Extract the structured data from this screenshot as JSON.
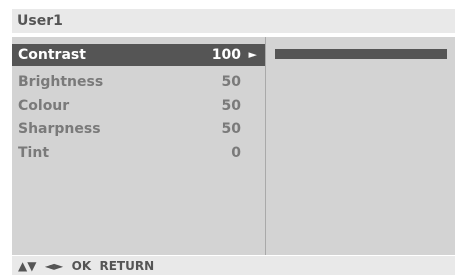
{
  "header": {
    "title": "User1"
  },
  "menu": {
    "items": [
      {
        "label": "Contrast",
        "value": "100",
        "arrow": "►",
        "selected": true
      },
      {
        "label": "Brightness",
        "value": "50"
      },
      {
        "label": "Colour",
        "value": "50"
      },
      {
        "label": "Sharpness",
        "value": "50"
      },
      {
        "label": "Tint",
        "value": "0"
      }
    ]
  },
  "level_bar": {
    "value": 100,
    "max": 100
  },
  "footer": {
    "hints": "▲▼  ◄►  OK  RETURN"
  },
  "colors": {
    "highlight": "#555555",
    "panel": "#d3d3d3",
    "header": "#e9e9e9"
  }
}
